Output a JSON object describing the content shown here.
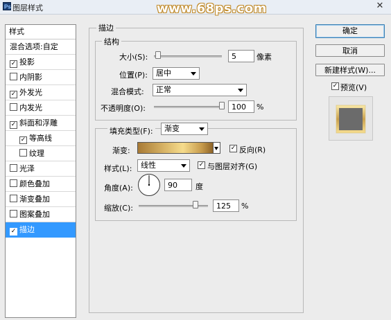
{
  "window": {
    "title": "图层样式"
  },
  "watermark": "www.68ps.com",
  "close_glyph": "✕",
  "style_list": {
    "header": "样式",
    "blend_options": "混合选项:自定",
    "items": [
      {
        "label": "投影",
        "checked": true
      },
      {
        "label": "内阴影",
        "checked": false
      },
      {
        "label": "外发光",
        "checked": true
      },
      {
        "label": "内发光",
        "checked": false
      },
      {
        "label": "斜面和浮雕",
        "checked": true
      },
      {
        "label": "等高线",
        "checked": true
      },
      {
        "label": "纹理",
        "checked": false
      },
      {
        "label": "光泽",
        "checked": false
      },
      {
        "label": "颜色叠加",
        "checked": false
      },
      {
        "label": "渐变叠加",
        "checked": false
      },
      {
        "label": "图案叠加",
        "checked": false
      },
      {
        "label": "描边",
        "checked": true
      }
    ]
  },
  "stroke": {
    "section_title": "描边",
    "structure": {
      "title": "结构",
      "size_label": "大小(S):",
      "size_value": "5",
      "size_unit": "像素",
      "position_label": "位置(P):",
      "position_value": "居中",
      "blend_label": "混合模式:",
      "blend_value": "正常",
      "opacity_label": "不透明度(O):",
      "opacity_value": "100",
      "opacity_unit": "%"
    },
    "fill": {
      "type_label": "填充类型(F):",
      "type_value": "渐变",
      "gradient_label": "渐变:",
      "reverse_label": "反向(R)",
      "reverse_checked": true,
      "style_label": "样式(L):",
      "style_value": "线性",
      "align_label": "与图层对齐(G)",
      "align_checked": true,
      "angle_label": "角度(A):",
      "angle_value": "90",
      "angle_unit": "度",
      "scale_label": "缩放(C):",
      "scale_value": "125",
      "scale_unit": "%"
    }
  },
  "buttons": {
    "ok": "确定",
    "cancel": "取消",
    "new_style": "新建样式(W)...",
    "preview_label": "预览(V)",
    "preview_checked": true
  },
  "colors": {
    "selection": "#3399ff",
    "gradient_start": "#a87a35",
    "gradient_mid": "#f6dc8c",
    "gradient_end": "#8e6428"
  }
}
